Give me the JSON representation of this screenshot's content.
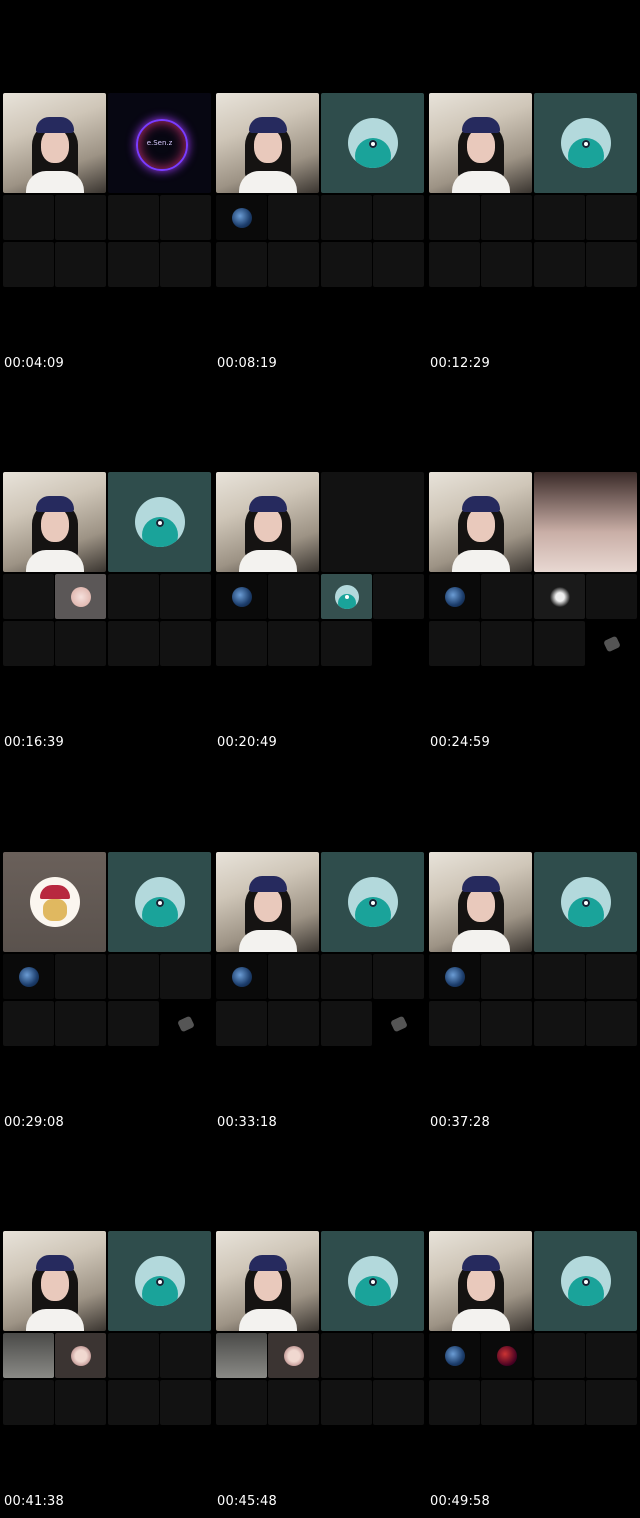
{
  "timestamps": [
    "00:04:09",
    "00:08:19",
    "00:12:29",
    "00:16:39",
    "00:20:49",
    "00:24:59",
    "00:29:08",
    "00:33:18",
    "00:37:28",
    "00:41:38",
    "00:45:48",
    "00:49:58"
  ],
  "orb_label": "e.Sen.z"
}
